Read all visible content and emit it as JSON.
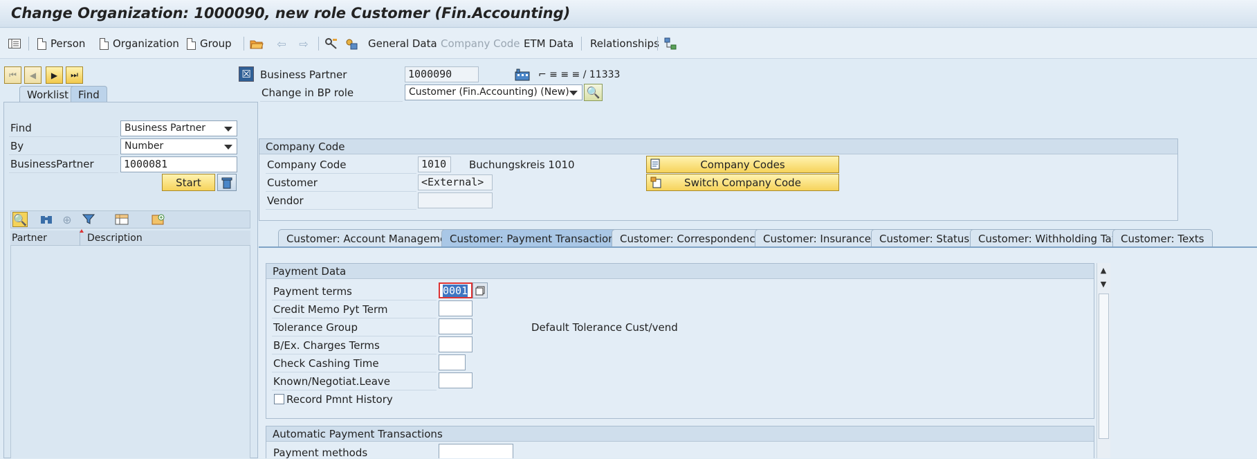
{
  "window": {
    "title": "Change Organization: 1000090, new role Customer (Fin.Accounting)"
  },
  "toolbar": {
    "person": "Person",
    "organization": "Organization",
    "group": "Group",
    "general_data": "General Data",
    "company_code": "Company Code",
    "etm_data": "ETM Data",
    "relationships": "Relationships"
  },
  "header": {
    "bp_label": "Business Partner",
    "bp_value": "1000090",
    "counter": "⌐ ≡ ≡ ≡ / 11333",
    "role_label": "Change in BP role",
    "role_value": "Customer (Fin.Accounting) (New)"
  },
  "locator": {
    "tabs": [
      "Worklist",
      "Find"
    ],
    "active_tab": "Find",
    "find_label": "Find",
    "find_value": "Business Partner",
    "by_label": "By",
    "by_value": "Number",
    "bp_label": "BusinessPartner",
    "bp_value": "1000081",
    "start_button": "Start",
    "columns": [
      "Partner",
      "Description"
    ]
  },
  "company_code_group": {
    "title": "Company Code",
    "cc_label": "Company Code",
    "cc_value": "1010",
    "cc_desc": "Buchungskreis 1010",
    "customer_label": "Customer",
    "customer_value": "<External>",
    "vendor_label": "Vendor",
    "vendor_value": "",
    "company_codes_button": "Company Codes",
    "switch_button": "Switch Company Code"
  },
  "tabs": [
    "Customer: Account Management",
    "Customer: Payment Transactions",
    "Customer: Correspondence",
    "Customer: Insurance",
    "Customer: Status",
    "Customer: Withholding Tax",
    "Customer: Texts"
  ],
  "active_tab": "Customer: Payment Transactions",
  "payment_data": {
    "title": "Payment Data",
    "payment_terms_label": "Payment terms",
    "payment_terms_value": "0001",
    "credit_memo_label": "Credit Memo Pyt Term",
    "tolerance_label": "Tolerance Group",
    "tolerance_desc": "Default Tolerance Cust/vend",
    "bex_label": "B/Ex. Charges Terms",
    "check_cashing_label": "Check Cashing Time",
    "known_label": "Known/Negotiat.Leave",
    "record_label": "Record Pmnt History"
  },
  "auto_payment": {
    "title": "Automatic Payment Transactions",
    "payment_methods_label": "Payment methods"
  }
}
